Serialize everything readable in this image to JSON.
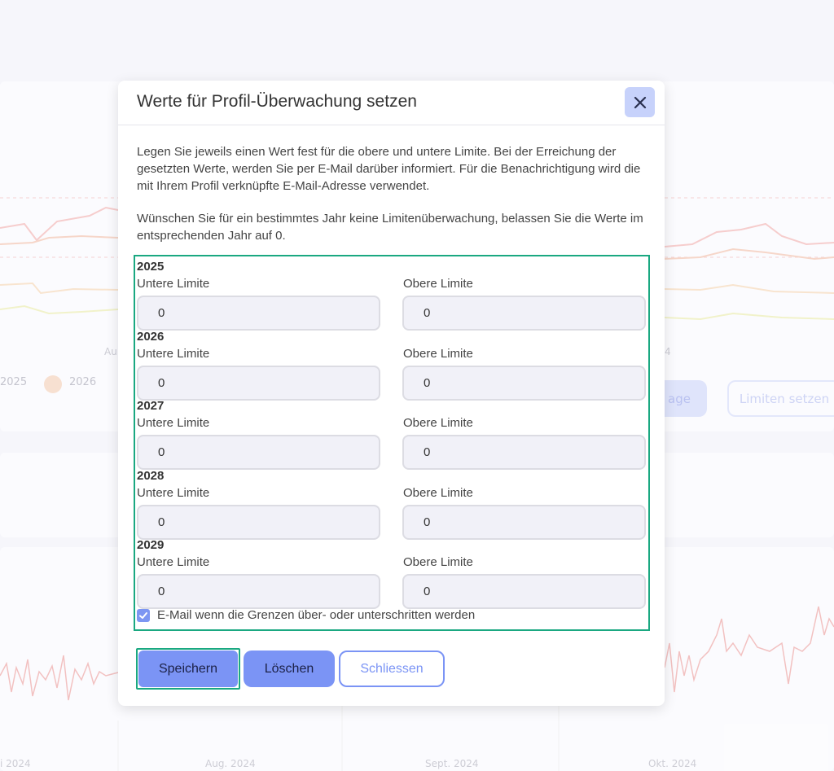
{
  "background": {
    "legend": [
      "2025",
      "2026"
    ],
    "buttons": [
      "age",
      "Limiten setzen"
    ],
    "x_axis_top": [
      "Au",
      "4"
    ],
    "x_axis_bottom": [
      "i 2024",
      "Aug. 2024",
      "Sept. 2024",
      "Okt. 2024"
    ]
  },
  "modal": {
    "title": "Werte für Profil-Überwachung setzen",
    "close_icon": "close-icon",
    "paragraph1": "Legen Sie jeweils einen Wert fest für die obere und untere Limite. Bei der Erreichung der gesetzten Werte, werden Sie per E-Mail darüber informiert. Für die Benachrichtigung wird die mit Ihrem Profil verknüpfte E-Mail-Adresse verwendet.",
    "paragraph2": "Wünschen Sie für ein bestimmtes Jahr keine Limitenüberwachung, belassen Sie die Werte im entsprechenden Jahr auf 0.",
    "years": [
      {
        "year": "2025",
        "lower_label": "Untere Limite",
        "upper_label": "Obere Limite",
        "lower_value": "0",
        "upper_value": "0"
      },
      {
        "year": "2026",
        "lower_label": "Untere Limite",
        "upper_label": "Obere Limite",
        "lower_value": "0",
        "upper_value": "0"
      },
      {
        "year": "2027",
        "lower_label": "Untere Limite",
        "upper_label": "Obere Limite",
        "lower_value": "0",
        "upper_value": "0"
      },
      {
        "year": "2028",
        "lower_label": "Untere Limite",
        "upper_label": "Obere Limite",
        "lower_value": "0",
        "upper_value": "0"
      },
      {
        "year": "2029",
        "lower_label": "Untere Limite",
        "upper_label": "Obere Limite",
        "lower_value": "0",
        "upper_value": "0"
      }
    ],
    "email_checkbox": {
      "checked": true,
      "label": "E-Mail wenn die Grenzen über- oder unterschritten werden"
    },
    "buttons": {
      "save": "Speichern",
      "delete": "Löschen",
      "close": "Schliessen"
    }
  },
  "colors": {
    "accent": "#7b94f5",
    "focus_outline": "#1aa881",
    "close_bg": "#c7d2fb"
  }
}
